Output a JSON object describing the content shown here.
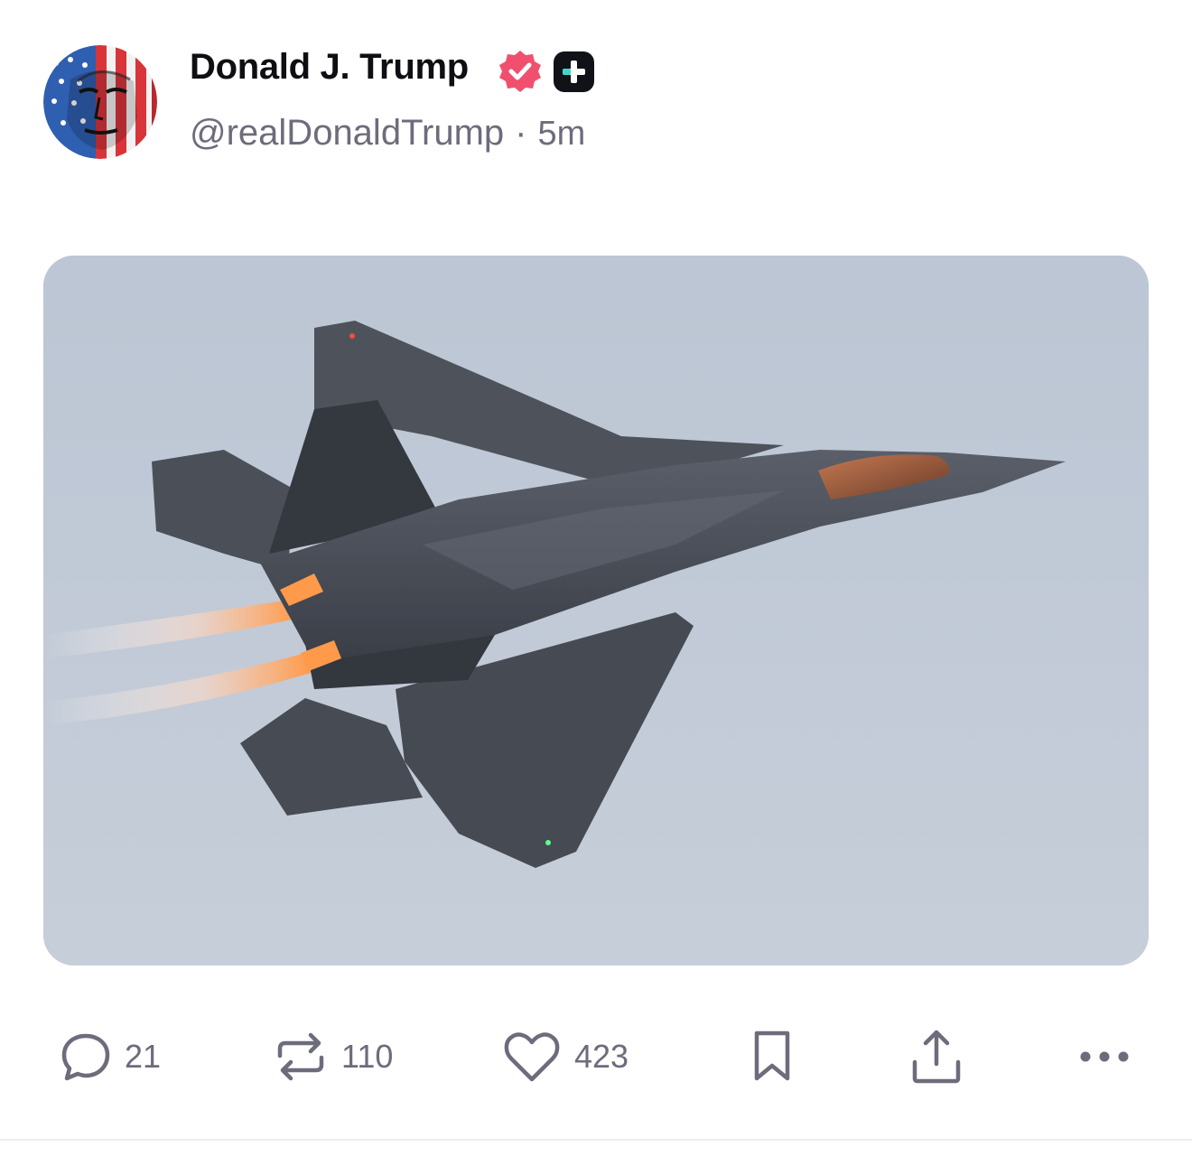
{
  "post": {
    "author": {
      "name": "Donald J. Trump",
      "handle": "@realDonaldTrump",
      "separator": "·",
      "time": "5m"
    },
    "badges": {
      "verified_color": "#f0506e",
      "plus_color": "#111118"
    },
    "media": {
      "icon": "fighter-jet-photo"
    },
    "actions": {
      "reply_count": "21",
      "repost_count": "110",
      "like_count": "423"
    }
  }
}
